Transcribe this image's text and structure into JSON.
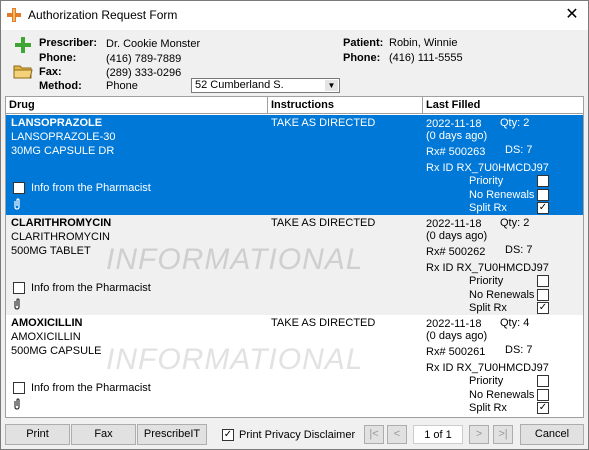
{
  "window": {
    "title": "Authorization Request Form",
    "close_symbol": "✕"
  },
  "header": {
    "prescriber_label": "Prescriber:",
    "prescriber_value": "Dr. Cookie Monster",
    "phone_label": "Phone:",
    "phone_value": "(416) 789-7889",
    "fax_label": "Fax:",
    "fax_value": "(289) 333-0296",
    "method_label": "Method:",
    "method_value": "Phone",
    "location_selected": "52 Cumberland S.",
    "patient_label": "Patient:",
    "patient_value": "Robin, Winnie",
    "patient_phone_label": "Phone:",
    "patient_phone_value": "(416) 111-5555"
  },
  "grid": {
    "columns": [
      "Drug",
      "Instructions",
      "Last Filled"
    ],
    "rows": [
      {
        "drug_name": "LANSOPRAZOLE",
        "drug_generic": "LANSOPRAZOLE-30",
        "drug_form": "30MG CAPSULE DR",
        "instructions": "TAKE AS DIRECTED",
        "date": "2022-11-18",
        "days_ago": "(0 days ago)",
        "qty": "Qty: 2",
        "rx": "Rx# 500263",
        "ds": "DS: 7",
        "rxid": "Rx ID RX_7U0HMCDJ97",
        "info_label": "Info from the Pharmacist",
        "watermark": "",
        "priority_label": "Priority",
        "no_renewals_label": "No Renewals",
        "split_rx_label": "Split Rx",
        "priority_checked": false,
        "no_renewals_checked": false,
        "split_rx_checked": true,
        "info_checked": false,
        "selected": true
      },
      {
        "drug_name": "CLARITHROMYCIN",
        "drug_generic": "CLARITHROMYCIN",
        "drug_form": "500MG TABLET",
        "instructions": "TAKE AS DIRECTED",
        "date": "2022-11-18",
        "days_ago": "(0 days ago)",
        "qty": "Qty: 2",
        "rx": "Rx# 500262",
        "ds": "DS: 7",
        "rxid": "Rx ID RX_7U0HMCDJ97",
        "info_label": "Info from the Pharmacist",
        "watermark": "INFORMATIONAL",
        "priority_label": "Priority",
        "no_renewals_label": "No Renewals",
        "split_rx_label": "Split Rx",
        "priority_checked": false,
        "no_renewals_checked": false,
        "split_rx_checked": true,
        "info_checked": false,
        "selected": false
      },
      {
        "drug_name": "AMOXICILLIN",
        "drug_generic": "AMOXICILLIN",
        "drug_form": "500MG CAPSULE",
        "instructions": "TAKE AS DIRECTED",
        "date": "2022-11-18",
        "days_ago": "(0 days ago)",
        "qty": "Qty: 4",
        "rx": "Rx# 500261",
        "ds": "DS: 7",
        "rxid": "Rx ID RX_7U0HMCDJ97",
        "info_label": "Info from the Pharmacist",
        "watermark": "INFORMATIONAL",
        "priority_label": "Priority",
        "no_renewals_label": "No Renewals",
        "split_rx_label": "Split Rx",
        "priority_checked": false,
        "no_renewals_checked": false,
        "split_rx_checked": true,
        "info_checked": false,
        "selected": false
      }
    ]
  },
  "footer": {
    "print_label": "Print",
    "fax_label": "Fax",
    "prescribeit_label": "PrescribeIT",
    "privacy_label": "Print Privacy Disclaimer",
    "privacy_checked": true,
    "page_indicator": "1 of 1",
    "first_symbol": "|<",
    "prev_symbol": "<",
    "next_symbol": ">",
    "last_symbol": ">|",
    "cancel_label": "Cancel"
  },
  "colors": {
    "selection": "#0078d7",
    "plus_icon": "#3fa535",
    "folder_icon": "#e8b642"
  }
}
